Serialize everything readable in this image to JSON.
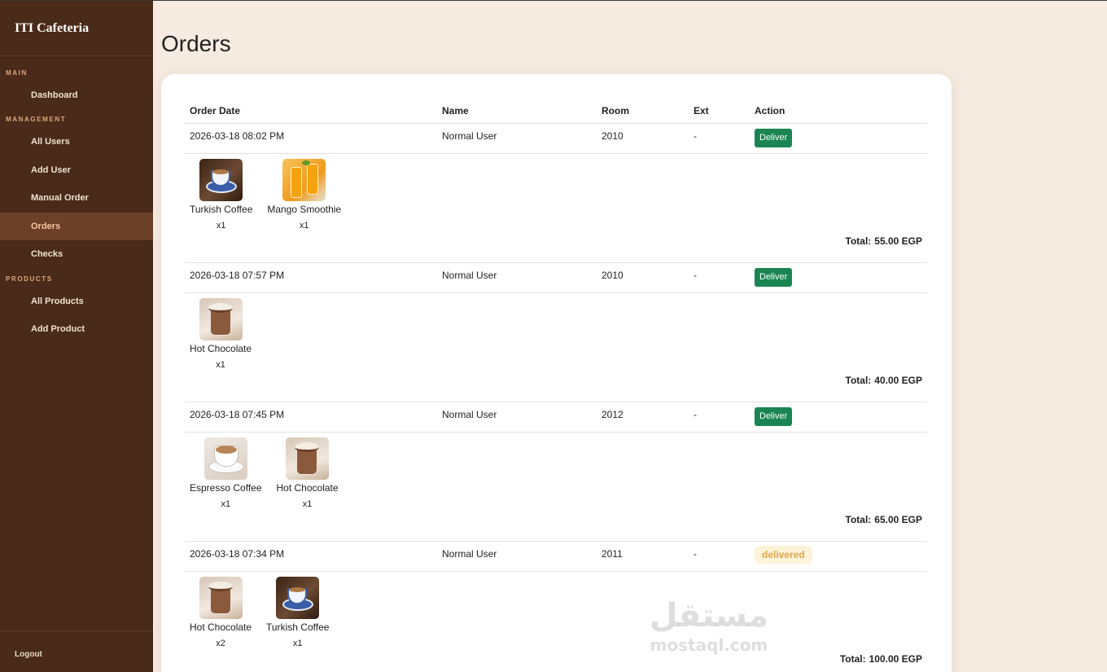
{
  "sidebar": {
    "brand": "ITI Cafeteria",
    "sections": [
      {
        "label": "MAIN",
        "items": [
          {
            "label": "Dashboard"
          }
        ]
      },
      {
        "label": "MANAGEMENT",
        "items": [
          {
            "label": "All Users"
          },
          {
            "label": "Add User"
          },
          {
            "label": "Manual Order"
          },
          {
            "label": "Orders",
            "active": true
          },
          {
            "label": "Checks"
          }
        ]
      },
      {
        "label": "PRODUCTS",
        "items": [
          {
            "label": "All Products"
          },
          {
            "label": "Add Product"
          }
        ]
      }
    ],
    "logout": "Logout"
  },
  "page": {
    "title": "Orders"
  },
  "table": {
    "headers": {
      "date": "Order Date",
      "name": "Name",
      "room": "Room",
      "ext": "Ext",
      "action": "Action"
    },
    "total_label": "Total:",
    "deliver_label": "Deliver",
    "delivered_label": "delivered"
  },
  "orders": [
    {
      "date": "2026-03-18 08:02 PM",
      "name": "Normal User",
      "room": "2010",
      "ext": "-",
      "status": "pending",
      "items": [
        {
          "name": "Turkish Coffee",
          "qty": "x1",
          "image": "turkish-coffee"
        },
        {
          "name": "Mango Smoothie",
          "qty": "x1",
          "image": "mango-smoothie"
        }
      ],
      "total": "55.00 EGP"
    },
    {
      "date": "2026-03-18 07:57 PM",
      "name": "Normal User",
      "room": "2010",
      "ext": "-",
      "status": "pending",
      "items": [
        {
          "name": "Hot Chocolate",
          "qty": "x1",
          "image": "hot-chocolate"
        }
      ],
      "total": "40.00 EGP"
    },
    {
      "date": "2026-03-18 07:45 PM",
      "name": "Normal User",
      "room": "2012",
      "ext": "-",
      "status": "pending",
      "items": [
        {
          "name": "Espresso Coffee",
          "qty": "x1",
          "image": "espresso-coffee"
        },
        {
          "name": "Hot Chocolate",
          "qty": "x1",
          "image": "hot-chocolate"
        }
      ],
      "total": "65.00 EGP"
    },
    {
      "date": "2026-03-18 07:34 PM",
      "name": "Normal User",
      "room": "2011",
      "ext": "-",
      "status": "delivered",
      "items": [
        {
          "name": "Hot Chocolate",
          "qty": "x2",
          "image": "hot-chocolate"
        },
        {
          "name": "Turkish Coffee",
          "qty": "x1",
          "image": "turkish-coffee"
        }
      ],
      "total": "100.00 EGP"
    }
  ],
  "watermark": {
    "arabic": "مستقل",
    "latin": "mostaql.com"
  },
  "colors": {
    "sidebar": "#4a2a18",
    "active_nav": "#6b4027",
    "deliver_button": "#1a8552",
    "delivered_badge_bg": "#fdf3d9",
    "delivered_badge_text": "#e0a64a",
    "background": "#f5ebe1"
  }
}
